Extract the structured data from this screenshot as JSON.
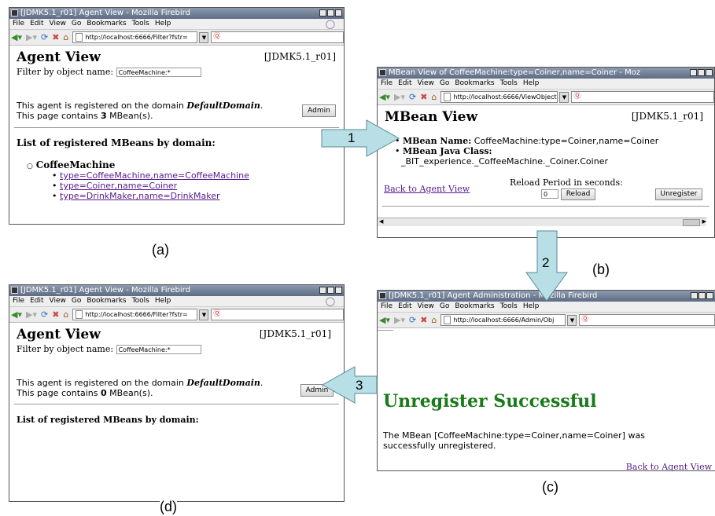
{
  "captions": {
    "a": "(a)",
    "b": "(b)",
    "c": "(c)",
    "d": "(d)"
  },
  "arrows": {
    "one": "1",
    "two": "2",
    "three": "3"
  },
  "menu": [
    "File",
    "Edit",
    "View",
    "Go",
    "Bookmarks",
    "Tools",
    "Help"
  ],
  "colors": {
    "heading_green": "#1a7a1a",
    "arrow_fill": "#b8dfe6",
    "link": "#551a8b"
  },
  "win_a": {
    "title": "[JDMK5.1_r01] Agent View - Mozilla Firebird",
    "url": "http://localhost:6666/Filter?fstr=",
    "heading": "Agent View",
    "agent_id": "[JDMK5.1_r01]",
    "filter_label": "Filter by object name:",
    "filter_value": "CoffeeMachine:*",
    "domain_prefix": "This agent is registered on the domain ",
    "domain_name": "DefaultDomain",
    "domain_suffix": ".",
    "contains_prefix": "This page contains ",
    "count": "3",
    "contains_suffix": " MBean(s).",
    "admin": "Admin",
    "list_heading": "List of registered MBeans by domain:",
    "domain_item": "CoffeeMachine",
    "links": [
      "type=CoffeeMachine,name=CoffeeMachine",
      "type=Coiner,name=Coiner",
      "type=DrinkMaker,name=DrinkMaker"
    ]
  },
  "win_b": {
    "title": "MBean View of CoffeeMachine:type=Coiner,name=Coiner - Moz",
    "url": "http://localhost:6666/ViewObject",
    "heading": "MBean View",
    "agent_id": "[JDMK5.1_r01]",
    "name_label": "MBean Name:",
    "name_value": " CoffeeMachine:type=Coiner,name=Coiner",
    "class_label": "MBean Java Class:",
    "class_value": "_BIT_experience._CoffeeMachine._Coiner.Coiner",
    "back_link": "Back to Agent View",
    "reload_label": "Reload Period in seconds:",
    "reload_value": "0",
    "reload_btn": "Reload",
    "unregister_btn": "Unregister"
  },
  "win_c": {
    "title": "[JDMK5.1_r01] Agent Administration - Mozilla Firebird",
    "url": "http://localhost:6666/Admin/Obj",
    "heading": "Unregister Successful",
    "message_line1": "The MBean [CoffeeMachine:type=Coiner,name=Coiner] was",
    "message_line2": "successfully unregistered.",
    "back_link": "Back to Agent View"
  },
  "win_d": {
    "title": "[JDMK5.1_r01] Agent View - Mozilla Firebird",
    "url": "http://localhost:6666/Filter?fstr=",
    "heading": "Agent View",
    "agent_id": "[JDMK5.1_r01]",
    "filter_label": "Filter by object name:",
    "filter_value": "CoffeeMachine:*",
    "domain_prefix": "This agent is registered on the domain ",
    "domain_name": "DefaultDomain",
    "domain_suffix": ".",
    "contains_prefix": "This page contains ",
    "count": "0",
    "contains_suffix": " MBean(s).",
    "admin": "Admin",
    "list_heading": "List of registered MBeans by domain:"
  }
}
